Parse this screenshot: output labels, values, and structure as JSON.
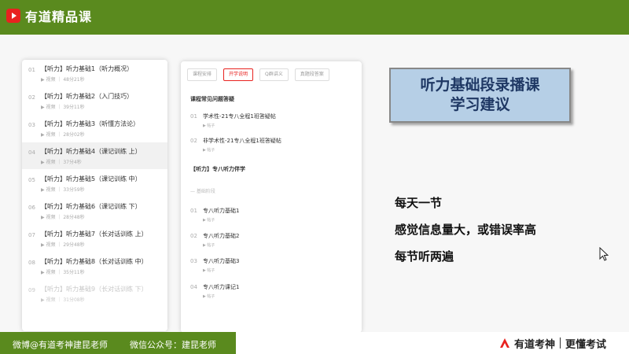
{
  "header": {
    "logo_text": "有道精品课"
  },
  "left_list": [
    {
      "num": "01",
      "title": "【听力】听力基础1（听力概况）",
      "meta": "▶ 视频 ｜ 48分21秒"
    },
    {
      "num": "02",
      "title": "【听力】听力基础2（入门技巧）",
      "meta": "▶ 视频 ｜ 39分11秒"
    },
    {
      "num": "03",
      "title": "【听力】听力基础3（听懂方法论）",
      "meta": "▶ 视频 ｜ 28分02秒"
    },
    {
      "num": "04",
      "title": "【听力】听力基础4（课记训练 上）",
      "meta": "▶ 视频 ｜ 37分4秒"
    },
    {
      "num": "05",
      "title": "【听力】听力基础5（课记训练 中）",
      "meta": "▶ 视频 ｜ 33分59秒"
    },
    {
      "num": "06",
      "title": "【听力】听力基础6（课记训练 下）",
      "meta": "▶ 视频 ｜ 28分48秒"
    },
    {
      "num": "07",
      "title": "【听力】听力基础7（长对话训练 上）",
      "meta": "▶ 视频 ｜ 29分48秒"
    },
    {
      "num": "08",
      "title": "【听力】听力基础8（长对话训练 中）",
      "meta": "▶ 视频 ｜ 35分11秒"
    },
    {
      "num": "09",
      "title": "【听力】听力基础9（长对话训练 下）",
      "meta": "▶ 视频 ｜ 31分08秒"
    }
  ],
  "mid_panel": {
    "tabs": [
      "课程安排",
      "开学说明",
      "Q群讲义",
      "真题段答案"
    ],
    "section1_heading": "课程常见问题答疑",
    "section1_items": [
      {
        "num": "01",
        "title": "学术性-21专八全程1班答疑帖",
        "meta": "▶ 帖子"
      },
      {
        "num": "02",
        "title": "非学术性-21专八全程1班答疑帖",
        "meta": "▶ 帖子"
      }
    ],
    "section2_heading": "【听力】专八听力伴学",
    "section2_divider": "—  基础阶段",
    "section2_items": [
      {
        "num": "01",
        "title": "专八听力基础1",
        "meta": "▶ 帖子"
      },
      {
        "num": "02",
        "title": "专八听力基础2",
        "meta": "▶ 帖子"
      },
      {
        "num": "03",
        "title": "专八听力基础3",
        "meta": "▶ 帖子"
      },
      {
        "num": "04",
        "title": "专八听力课记1",
        "meta": "▶ 帖子"
      }
    ]
  },
  "title_box": {
    "line1": "听力基础段录播课",
    "line2": "学习建议"
  },
  "advice": {
    "line1": "每天一节",
    "line2": "感觉信息量大，或错误率高",
    "line3": "每节听两遍"
  },
  "footer": {
    "weibo": "微博@有道考神建昆老师",
    "wechat": "微信公众号：建昆老师",
    "brand_name": "有道考神",
    "brand_slogan": "更懂考试"
  }
}
